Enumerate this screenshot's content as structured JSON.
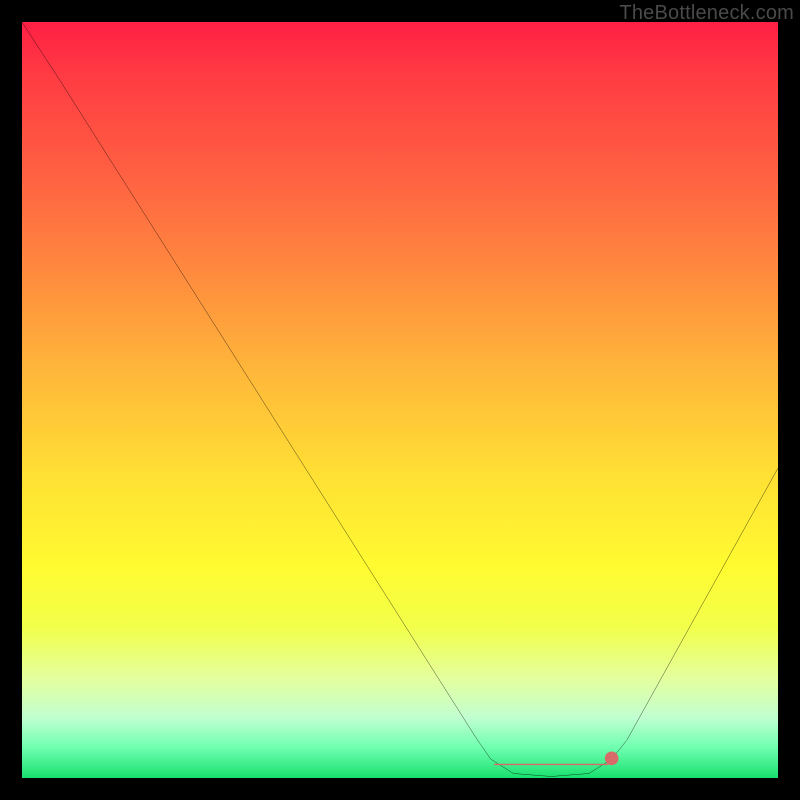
{
  "watermark": "TheBottleneck.com",
  "colors": {
    "page_bg": "#000000",
    "curve": "#000000",
    "marker": "#d86a6a",
    "gradient_top": "#ff1f44",
    "gradient_bottom": "#18e06e"
  },
  "chart_data": {
    "type": "line",
    "title": "",
    "xlabel": "",
    "ylabel": "",
    "xlim": [
      0,
      100
    ],
    "ylim": [
      0,
      100
    ],
    "series": [
      {
        "name": "bottleneck-curve",
        "x": [
          0,
          5,
          10,
          15,
          20,
          25,
          30,
          35,
          40,
          45,
          50,
          55,
          60,
          62,
          65,
          70,
          75,
          78,
          80,
          85,
          90,
          95,
          100
        ],
        "y": [
          100,
          92.3,
          84.4,
          76.5,
          68.6,
          60.7,
          52.8,
          44.9,
          37.0,
          29.1,
          21.2,
          13.3,
          5.4,
          2.5,
          0.6,
          0.2,
          0.6,
          2.5,
          5.0,
          14.0,
          23.0,
          32.0,
          41.0
        ]
      }
    ],
    "markers": [
      {
        "name": "flat-min-segment",
        "x_range": [
          62.5,
          77.5
        ],
        "y": 1.8
      },
      {
        "name": "right-end-dot",
        "x": 78.0,
        "y": 2.6
      }
    ]
  }
}
